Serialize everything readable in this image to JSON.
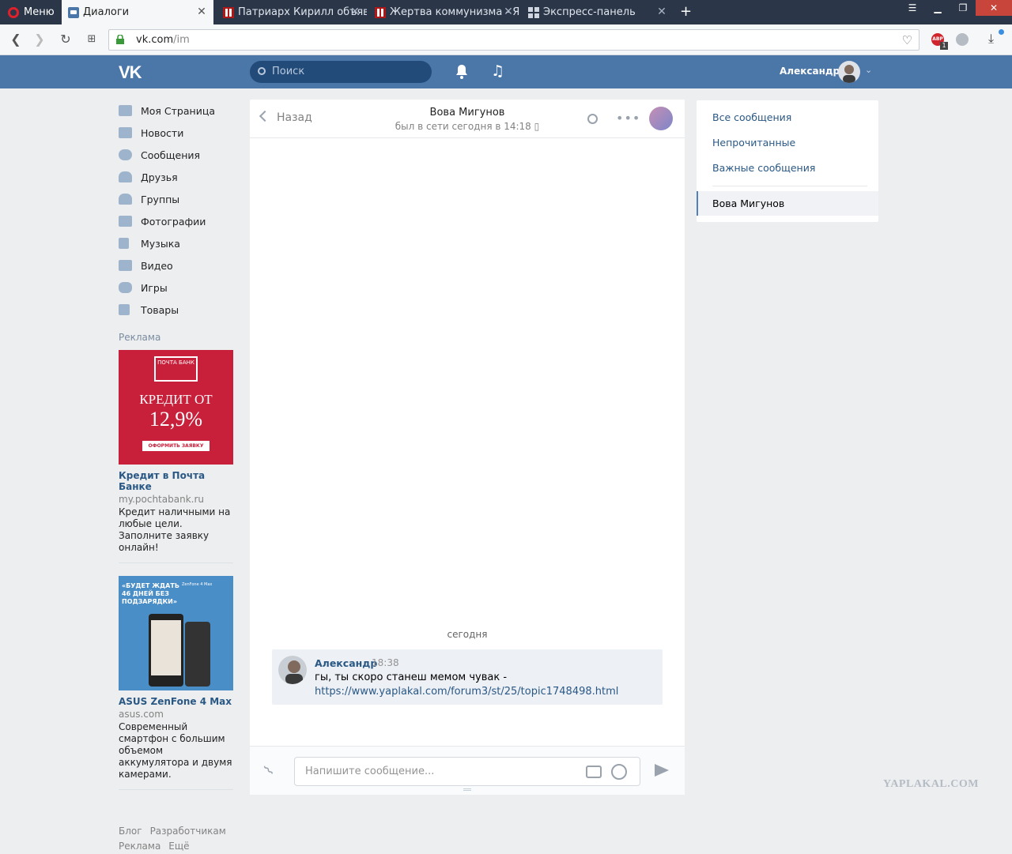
{
  "browser": {
    "menu_label": "Меню",
    "tabs": [
      {
        "title": "Диалоги",
        "active": true
      },
      {
        "title": "Патриарх Кирилл объяви",
        "active": false
      },
      {
        "title": "Жертва коммунизма - ЯП",
        "active": false
      },
      {
        "title": "Экспресс-панель",
        "active": false
      }
    ],
    "url_host": "vk.com",
    "url_path": "/im",
    "abp_label": "ABP",
    "abp_count": "1"
  },
  "header": {
    "logo": "VK",
    "search_placeholder": "Поиск",
    "user_name": "Александр"
  },
  "sidebar": {
    "items": [
      {
        "label": "Моя Страница",
        "icon": "home-icon"
      },
      {
        "label": "Новости",
        "icon": "news-icon"
      },
      {
        "label": "Сообщения",
        "icon": "messages-icon"
      },
      {
        "label": "Друзья",
        "icon": "friends-icon"
      },
      {
        "label": "Группы",
        "icon": "groups-icon"
      },
      {
        "label": "Фотографии",
        "icon": "camera-icon"
      },
      {
        "label": "Музыка",
        "icon": "music-icon"
      },
      {
        "label": "Видео",
        "icon": "video-icon"
      },
      {
        "label": "Игры",
        "icon": "gamepad-icon"
      },
      {
        "label": "Товары",
        "icon": "bag-icon"
      }
    ],
    "ads_heading": "Реклама",
    "ads": [
      {
        "banner_logo": "ПОЧТА БАНК",
        "banner_title": "КРЕДИТ ОТ",
        "banner_rate": "12,9%",
        "banner_cta": "ОФОРМИТЬ ЗАЯВКУ",
        "title": "Кредит в Почта Банке",
        "site": "my.pochtabank.ru",
        "text": "Кредит наличными на любые цели. Заполните заявку онлайн!"
      },
      {
        "banner_title": "«БУДЕТ ЖДАТЬ 46 ДНЕЙ БЕЗ ПОДЗАРЯДКИ»",
        "banner_sub": "ZenFone 4 Max",
        "title": "ASUS ZenFone 4 Max",
        "site": "asus.com",
        "text": "Современный смартфон с большим объемом аккумулятора и двумя камерами."
      }
    ],
    "footer": [
      "Блог",
      "Разработчикам",
      "Реклама",
      "Ещё"
    ]
  },
  "chat": {
    "back_label": "Назад",
    "title": "Вова Мигунов",
    "status": "был в сети сегодня в 14:18",
    "day_divider": "сегодня",
    "messages": [
      {
        "author": "Александр",
        "time": "18:38",
        "text": "гы, ты скоро станеш мемом чувак -",
        "link": "https://www.yaplakal.com/forum3/st/25/topic1748498.html"
      }
    ],
    "composer_placeholder": "Напишите сообщение..."
  },
  "right_panel": {
    "filters": [
      "Все сообщения",
      "Непрочитанные",
      "Важные сообщения"
    ],
    "selected_dialog": "Вова Мигунов"
  },
  "watermark": "YAPLAKAL.COM",
  "colors": {
    "vk_blue": "#4a76a8",
    "link": "#2a5885",
    "background": "#edeef0"
  }
}
